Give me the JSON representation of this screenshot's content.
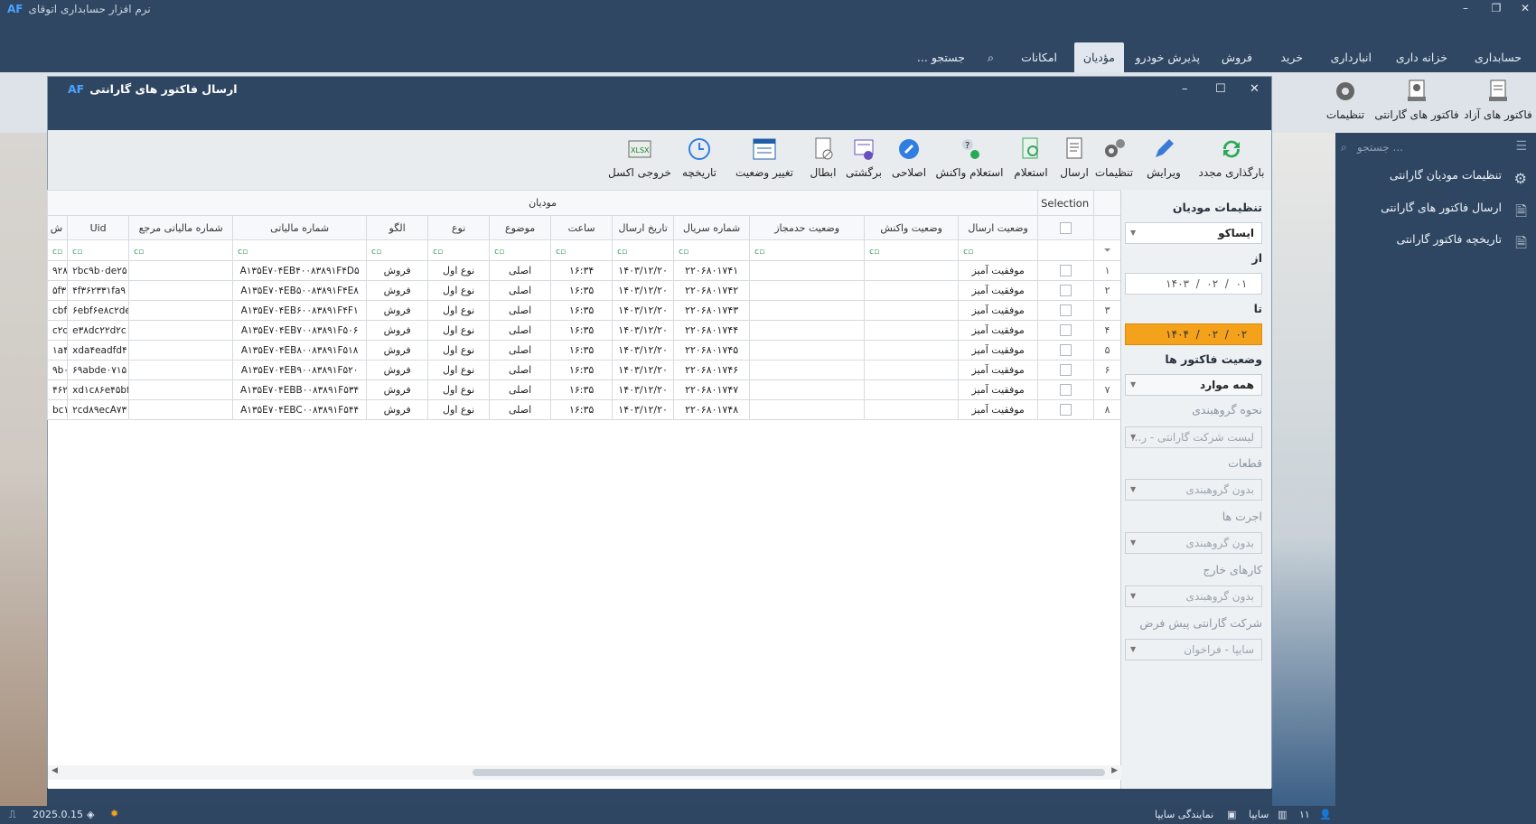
{
  "app": {
    "title": "نرم افزار حسابداری اتوقای",
    "logo": "AF"
  },
  "menu": {
    "items": [
      "حسابداری",
      "خزانه داری",
      "انبارداری",
      "خرید",
      "فروش",
      "پذیرش خودرو",
      "مؤدیان",
      "امکانات"
    ],
    "active": "مؤدیان",
    "search": "جستجو ..."
  },
  "ribbon": {
    "buttons": [
      "فاکتور های آزاد",
      "فاکتور های گارانتی",
      "تنظیمات"
    ]
  },
  "sidebar": {
    "search_placeholder": "جستجو ...",
    "items": [
      "تنظیمات مودیان گارانتی",
      "ارسال فاکتور های گارانتی",
      "تاریخچه فاکتور گارانتی"
    ]
  },
  "dialog": {
    "title": "ارسال فاکتور های گارانتی",
    "toolbar": [
      "بارگذاری مجدد",
      "ویرایش",
      "تنظیمات",
      "ارسال",
      "استعلام",
      "استعلام واکنش",
      "اصلاحی",
      "برگشتی",
      "ابطال",
      "تغییر وضعیت",
      "تاریخچه",
      "خروجی اکسل"
    ],
    "filters": {
      "title": "تنظیمات مودیان",
      "company": "ایساکو",
      "from_label": "از",
      "from_date": {
        "d": "۰۱",
        "m": "۰۲",
        "y": "۱۴۰۳"
      },
      "to_label": "تا",
      "to_date": {
        "d": "۰۲",
        "m": "۰۲",
        "y": "۱۴۰۴"
      },
      "status_label": "وضعیت فاکتور ها",
      "status": "همه موارد",
      "grouping_label": "نحوه گروهبندی",
      "grouping": "لیست شرکت گارانتی - ر...",
      "parts_label": "قطعات",
      "parts": "بدون گروهبندی",
      "wages_label": "اجرت ها",
      "wages": "بدون گروهبندی",
      "external_label": "کارهای خارج",
      "external": "بدون گروهبندی",
      "default_company_label": "شرکت گارانتی پیش فرض",
      "default_company": "سایپا - فراخوان"
    },
    "grid": {
      "group_selection": "Selection",
      "group_main": "مودیان",
      "columns": [
        "وضعیت ارسال",
        "وضعیت واکنش",
        "وضعیت حدمجاز",
        "شماره سریال",
        "تاریخ ارسال",
        "ساعت",
        "موضوع",
        "نوع",
        "الگو",
        "شماره مالیاتی",
        "شماره مالیاتی مرجع",
        "Uid",
        "ش"
      ],
      "rows": [
        {
          "n": "۱",
          "status": "موفقیت آمیز",
          "serial": "۲۲۰۶۸۰۱۷۴۱",
          "date": "۱۴۰۳/۱۲/۲۰",
          "time": "۱۶:۳۴",
          "subject": "اصلی",
          "type": "نوع اول",
          "pattern": "فروش",
          "tax": "A۱۳۵E۷۰۴EB۴۰۰۸۳۸۹۱F۴D۵",
          "uid": "۲bc۹b۰de۲۵",
          "x": "۹۲۸"
        },
        {
          "n": "۲",
          "status": "موفقیت آمیز",
          "serial": "۲۲۰۶۸۰۱۷۴۲",
          "date": "۱۴۰۳/۱۲/۲۰",
          "time": "۱۶:۳۵",
          "subject": "اصلی",
          "type": "نوع اول",
          "pattern": "فروش",
          "tax": "A۱۳۵E۷۰۴EB۵۰۰۸۳۸۹۱F۴E۸",
          "uid": "۴f۳۶۲۳۳۱fa۹",
          "x": "۵f۳"
        },
        {
          "n": "۳",
          "status": "موفقیت آمیز",
          "serial": "۲۲۰۶۸۰۱۷۴۳",
          "date": "۱۴۰۳/۱۲/۲۰",
          "time": "۱۶:۳۵",
          "subject": "اصلی",
          "type": "نوع اول",
          "pattern": "فروش",
          "tax": "A۱۳۵E۷۰۴EB۶۰۰۸۳۸۹۱F۴F۱",
          "uid": "۶ebf۶e۸c۲de",
          "x": "cbf"
        },
        {
          "n": "۴",
          "status": "موفقیت آمیز",
          "serial": "۲۲۰۶۸۰۱۷۴۴",
          "date": "۱۴۰۳/۱۲/۲۰",
          "time": "۱۶:۳۵",
          "subject": "اصلی",
          "type": "نوع اول",
          "pattern": "فروش",
          "tax": "A۱۳۵E۷۰۴EB۷۰۰۸۳۸۹۱F۵۰۶",
          "uid": "e۳۸dc۲۲d۲c",
          "x": "c۲d"
        },
        {
          "n": "۵",
          "status": "موفقیت آمیز",
          "serial": "۲۲۰۶۸۰۱۷۴۵",
          "date": "۱۴۰۳/۱۲/۲۰",
          "time": "۱۶:۳۵",
          "subject": "اصلی",
          "type": "نوع اول",
          "pattern": "فروش",
          "tax": "A۱۳۵E۷۰۴EB۸۰۰۸۳۸۹۱F۵۱۸",
          "uid": "xda۴eadfd۴",
          "x": "۱a۴"
        },
        {
          "n": "۶",
          "status": "موفقیت آمیز",
          "serial": "۲۲۰۶۸۰۱۷۴۶",
          "date": "۱۴۰۳/۱۲/۲۰",
          "time": "۱۶:۳۵",
          "subject": "اصلی",
          "type": "نوع اول",
          "pattern": "فروش",
          "tax": "A۱۳۵E۷۰۴EB۹۰۰۸۳۸۹۱F۵۲۰",
          "uid": "۶۹abde۰۷۱۵",
          "x": "۹b۰"
        },
        {
          "n": "۷",
          "status": "موفقیت آمیز",
          "serial": "۲۲۰۶۸۰۱۷۴۷",
          "date": "۱۴۰۳/۱۲/۲۰",
          "time": "۱۶:۳۵",
          "subject": "اصلی",
          "type": "نوع اول",
          "pattern": "فروش",
          "tax": "A۱۳۵E۷۰۴EBB۰۰۸۳۸۹۱F۵۳۴",
          "uid": "xd۱c۸۶e۴۵bf",
          "x": "۴۶۲"
        },
        {
          "n": "۸",
          "status": "موفقیت آمیز",
          "serial": "۲۲۰۶۸۰۱۷۴۸",
          "date": "۱۴۰۳/۱۲/۲۰",
          "time": "۱۶:۳۵",
          "subject": "اصلی",
          "type": "نوع اول",
          "pattern": "فروش",
          "tax": "A۱۳۵E۷۰۴EBC۰۰۸۳۸۹۱F۵۴۴",
          "uid": "۲cd۸۹ecA۷۳",
          "x": "bc۱"
        }
      ]
    }
  },
  "status": {
    "version": "2025.0.15",
    "users": "۱۱",
    "company": "سایپا",
    "agency": "نمایندگی سایپا"
  },
  "colors": {
    "dark": "#2e4662",
    "accent": "#f4a11c",
    "ribbon": "#dde3e9"
  }
}
